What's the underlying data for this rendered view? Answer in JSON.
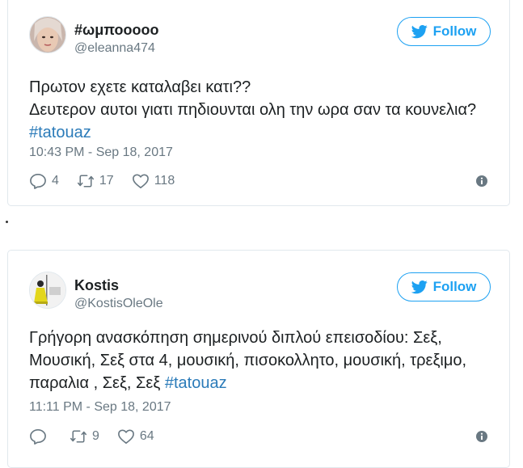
{
  "tweets": [
    {
      "name": "#ωμποοοοο",
      "handle": "@eleanna474",
      "follow_label": "Follow",
      "text_lines": [
        "Πρωτον εχετε καταλαβει κατι??",
        "Δευτερον αυτοι γιατι πηδιουνται ολη την ωρα σαν τα κουνελια?"
      ],
      "hashtag": "#tatouaz",
      "timestamp": "10:43 PM - Sep 18, 2017",
      "replies": "4",
      "retweets": "17",
      "likes": "118"
    },
    {
      "name": "Kostis",
      "handle": "@KostisOleOle",
      "follow_label": "Follow",
      "text_lines": [
        "Γρήγορη ανασκόπηση σημερινού διπλού επεισοδίου: Σεξ,",
        "Μουσική, Σεξ στα 4, μουσική, πισοκολλητο, μουσική, τρεξιμο,",
        "παραλια , Σεξ, Σεξ"
      ],
      "hashtag": "#tatouaz",
      "timestamp": "11:11 PM - Sep 18, 2017",
      "replies": "",
      "retweets": "9",
      "likes": "64"
    }
  ],
  "separator_text": ".",
  "colors": {
    "accent": "#1da1f2",
    "hashtag": "#2b7bb9",
    "muted": "#697882",
    "border": "#e1e8ed"
  },
  "icons": [
    "twitter-bird-icon",
    "reply-icon",
    "retweet-icon",
    "heart-icon",
    "info-icon"
  ]
}
